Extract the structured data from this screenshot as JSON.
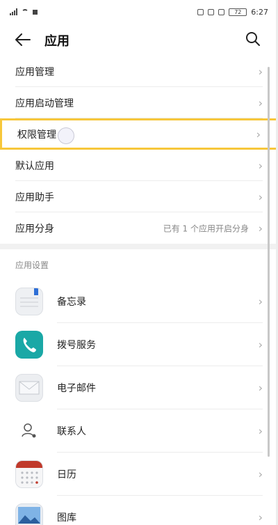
{
  "status": {
    "time": "6:27",
    "battery": "72"
  },
  "header": {
    "title": "应用"
  },
  "settings": [
    {
      "label": "应用管理"
    },
    {
      "label": "应用启动管理"
    },
    {
      "label": "权限管理"
    },
    {
      "label": "默认应用"
    },
    {
      "label": "应用助手"
    },
    {
      "label": "应用分身",
      "value": "已有 1 个应用开启分身"
    }
  ],
  "section": {
    "title": "应用设置"
  },
  "apps": [
    {
      "label": "备忘录",
      "icon": "memo-icon"
    },
    {
      "label": "拨号服务",
      "icon": "phone-icon"
    },
    {
      "label": "电子邮件",
      "icon": "email-icon"
    },
    {
      "label": "联系人",
      "icon": "contacts-icon"
    },
    {
      "label": "日历",
      "icon": "calendar-icon"
    },
    {
      "label": "图库",
      "icon": "gallery-icon"
    }
  ],
  "colors": {
    "highlight": "#f7c73b",
    "phone": "#1aa8a6",
    "calendar": "#c0392b"
  }
}
